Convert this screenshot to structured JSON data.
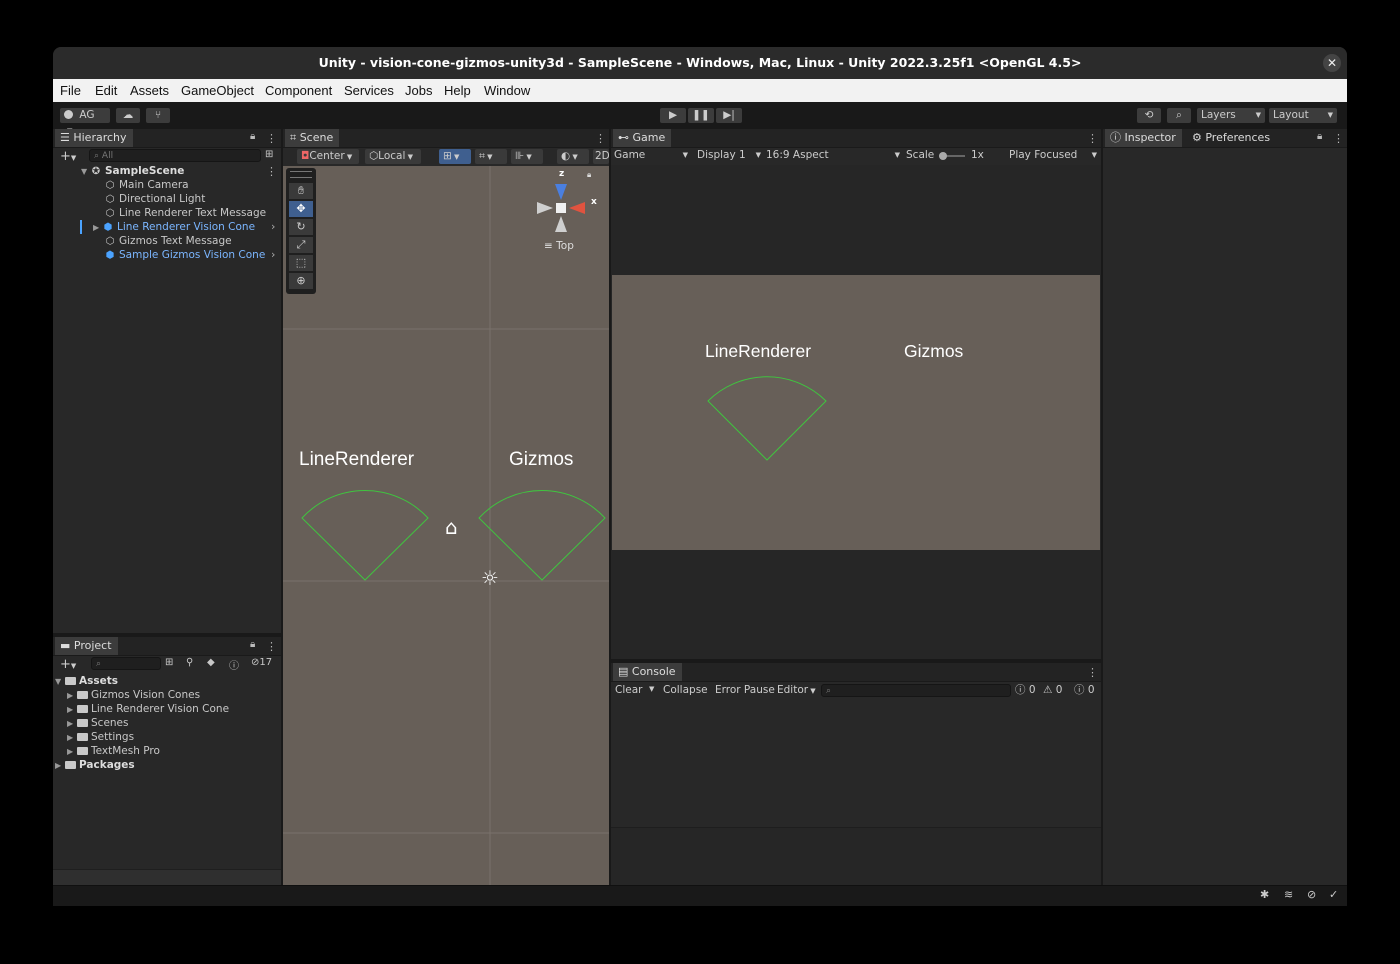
{
  "window": {
    "title": "Unity - vision-cone-gizmos-unity3d - SampleScene - Windows, Mac, Linux - Unity 2022.3.25f1 <OpenGL 4.5>",
    "close": "✕"
  },
  "menu": [
    "File",
    "Edit",
    "Assets",
    "GameObject",
    "Component",
    "Services",
    "Jobs",
    "Help",
    "Window"
  ],
  "toolbar": {
    "account": "AG",
    "layers": "Layers",
    "layout": "Layout"
  },
  "hierarchy": {
    "tab": "Hierarchy",
    "search_placeholder": "All",
    "scene": "SampleScene",
    "items": [
      {
        "label": "Main Camera",
        "prefab": false
      },
      {
        "label": "Directional Light",
        "prefab": false
      },
      {
        "label": "Line Renderer Text Message",
        "prefab": false
      },
      {
        "label": "Line Renderer Vision Cone",
        "prefab": true
      },
      {
        "label": "Gizmos Text Message",
        "prefab": false
      },
      {
        "label": "Sample Gizmos Vision Cone",
        "prefab": true
      }
    ]
  },
  "project": {
    "tab": "Project",
    "hidden_count": "17",
    "assets": "Assets",
    "folders": [
      "Gizmos Vision Cones",
      "Line Renderer Vision Cone",
      "Scenes",
      "Settings",
      "TextMesh Pro"
    ],
    "packages": "Packages"
  },
  "scene": {
    "tab": "Scene",
    "pivot": "Center",
    "space": "Local",
    "mode": "2D",
    "view_label": "Top",
    "axis_z": "z",
    "axis_x": "x",
    "text_left": "LineRenderer",
    "text_right": "Gizmos"
  },
  "game": {
    "tab": "Game",
    "mode": "Game",
    "display": "Display 1",
    "aspect": "16:9 Aspect",
    "scale_label": "Scale",
    "scale_value": "1x",
    "play_mode": "Play Focused",
    "text_left": "LineRenderer",
    "text_right": "Gizmos"
  },
  "console": {
    "tab": "Console",
    "clear": "Clear",
    "collapse": "Collapse",
    "error_pause": "Error Pause",
    "editor": "Editor",
    "log_count": "0",
    "warn_count": "0",
    "error_count": "0"
  },
  "inspector": {
    "tab": "Inspector",
    "prefs_tab": "Preferences"
  },
  "colors": {
    "scene_bg": "#675f58",
    "cone_green": "#3fc53f",
    "prefab_blue": "#7bb6ff"
  }
}
